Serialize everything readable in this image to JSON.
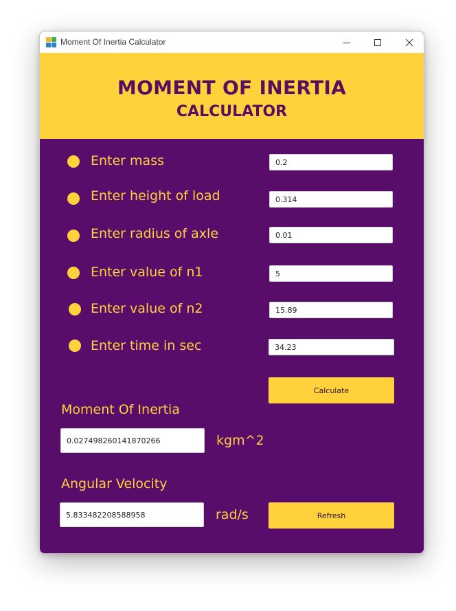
{
  "window": {
    "title": "Moment Of Inertia Calculator",
    "icon": "app-grid-icon",
    "controls": [
      "minimize-icon",
      "maximize-icon",
      "close-icon"
    ]
  },
  "header": {
    "line1": "MOMENT OF INERTIA",
    "line2": "CALCULATOR"
  },
  "form": {
    "fields": [
      {
        "label": "Enter mass",
        "value": "0.2"
      },
      {
        "label": "Enter height of load",
        "value": "0.314"
      },
      {
        "label": "Enter radius of axle",
        "value": "0.01"
      },
      {
        "label": "Enter value of n1",
        "value": "5"
      },
      {
        "label": "Enter value of n2",
        "value": "15.89"
      },
      {
        "label": "Enter time in sec",
        "value": "34.23"
      }
    ],
    "calculate_label": "Calculate",
    "refresh_label": "Refresh"
  },
  "results": {
    "inertia_label": "Moment Of Inertia",
    "inertia_value": "0.027498260141870266",
    "inertia_unit": "kgm^2",
    "velocity_label": "Angular Velocity",
    "velocity_value": "5.833482208588958",
    "velocity_unit": "rad/s"
  },
  "colors": {
    "background": "#570d69",
    "accent": "#ffd23c",
    "header_text": "#57105f"
  }
}
